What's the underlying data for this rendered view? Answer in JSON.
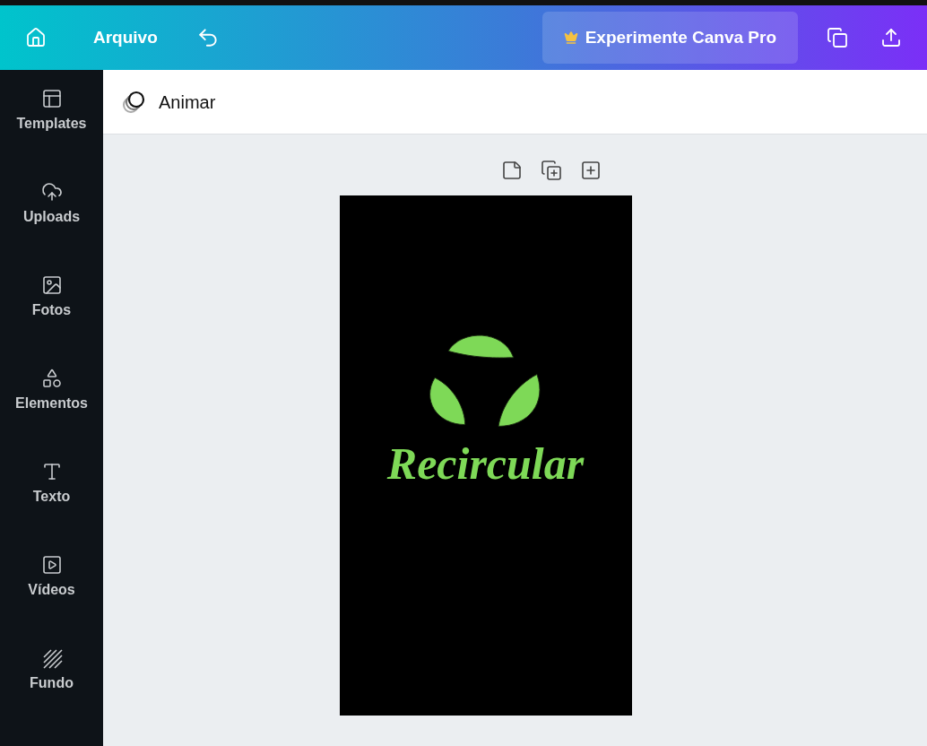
{
  "top_bar": {
    "file_menu": "Arquivo",
    "pro_button": "Experimente Canva Pro"
  },
  "toolbar": {
    "animate_button": "Animar"
  },
  "sidebar": {
    "items": [
      {
        "kind": "templates",
        "label": "Templates"
      },
      {
        "kind": "uploads",
        "label": "Uploads"
      },
      {
        "kind": "photos",
        "label": "Fotos"
      },
      {
        "kind": "elements",
        "label": "Elementos"
      },
      {
        "kind": "text",
        "label": "Texto"
      },
      {
        "kind": "videos",
        "label": "Vídeos"
      },
      {
        "kind": "background",
        "label": "Fundo"
      }
    ]
  },
  "design": {
    "headline": "Recircular"
  }
}
